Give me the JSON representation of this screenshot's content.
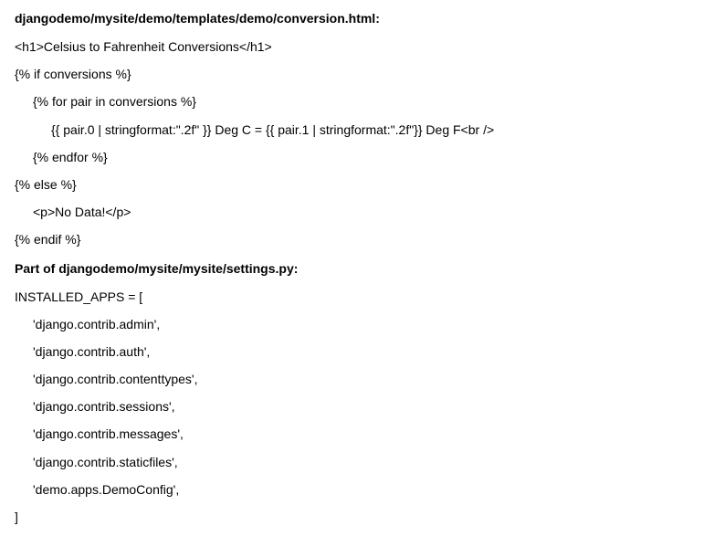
{
  "file1_heading": "djangodemo/mysite/demo/templates/demo/conversion.html:",
  "template_lines": {
    "l1": "<h1>Celsius to Fahrenheit Conversions</h1>",
    "l2": "{% if conversions %}",
    "l3": "{% for pair in conversions %}",
    "l4": "{{ pair.0 | stringformat:\".2f\" }} Deg C = {{ pair.1 | stringformat:\".2f\"}} Deg F<br />",
    "l5": "{% endfor %}",
    "l6": "{% else %}",
    "l7": "<p>No Data!</p>",
    "l8": "{% endif %}"
  },
  "file2_heading": "Part of djangodemo/mysite/mysite/settings.py:",
  "settings_lines": {
    "s1": "INSTALLED_APPS = [",
    "s2": "'django.contrib.admin',",
    "s3": "'django.contrib.auth',",
    "s4": "'django.contrib.contenttypes',",
    "s5": "'django.contrib.sessions',",
    "s6": "'django.contrib.messages',",
    "s7": "'django.contrib.staticfiles',",
    "s8": "'demo.apps.DemoConfig',",
    "s9": "]"
  }
}
